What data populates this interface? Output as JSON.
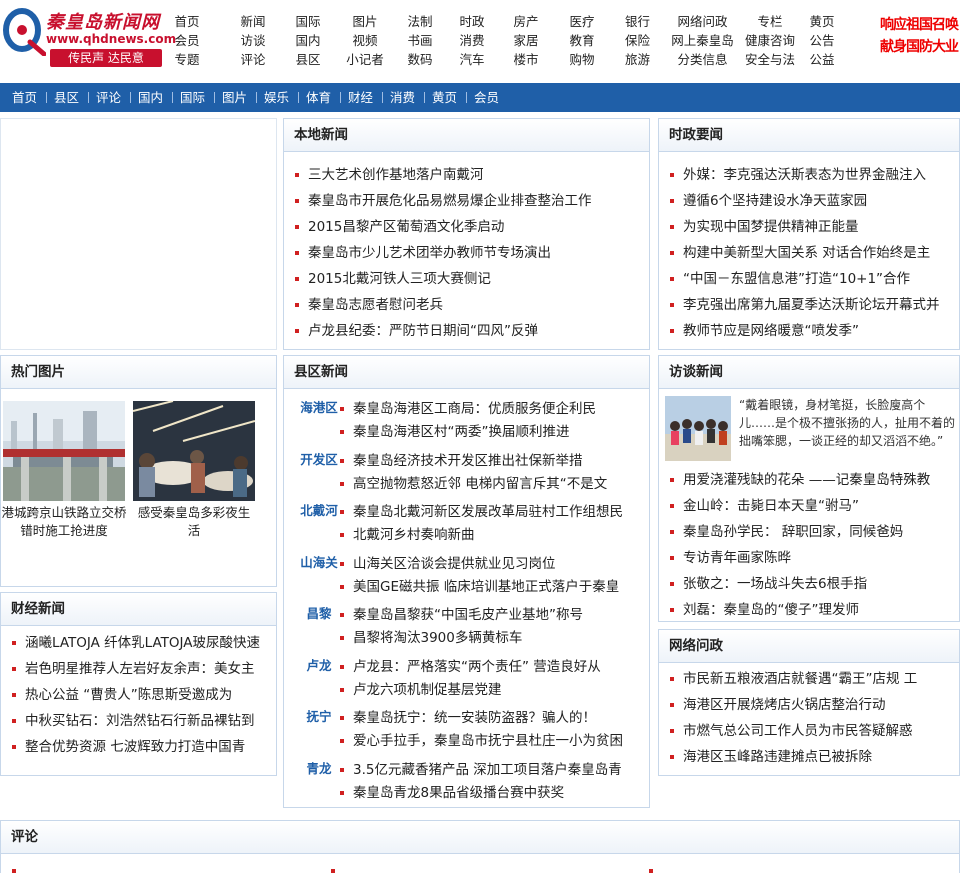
{
  "header": {
    "logo_name": "秦皇岛新闻网",
    "logo_url": "www.qhdnews.com",
    "logo_slogan": "传民声 达民意",
    "ad_line1": "响应祖国召唤",
    "ad_line2": "献身国防大业",
    "topnav_columns": [
      [
        "首页",
        "会员",
        "专题"
      ],
      [
        "新闻",
        "访谈",
        "评论"
      ],
      [
        "国际",
        "国内",
        "县区"
      ],
      [
        "图片",
        "视频",
        "小记者"
      ],
      [
        "法制",
        "书画",
        "数码"
      ],
      [
        "时政",
        "消费",
        "汽车"
      ],
      [
        "房产",
        "家居",
        "楼市"
      ],
      [
        "医疗",
        "教育",
        "购物"
      ],
      [
        "银行",
        "保险",
        "旅游"
      ],
      [
        "网络问政",
        "网上秦皇岛",
        "分类信息"
      ],
      [
        "专栏",
        "健康咨询",
        "安全与法"
      ],
      [
        "黄页",
        "公告",
        "公益"
      ]
    ]
  },
  "mainnav": [
    "首页",
    "县区",
    "评论",
    "国内",
    "国际",
    "图片",
    "娱乐",
    "体育",
    "财经",
    "消费",
    "黄页",
    "会员"
  ],
  "local_news": {
    "title": "本地新闻",
    "items": [
      "三大艺术创作基地落户南戴河",
      "秦皇岛市开展危化品易燃易爆企业排查整治工作",
      "2015昌黎产区葡萄酒文化季启动",
      "秦皇岛市少儿艺术团举办教师节专场演出",
      "2015北戴河铁人三项大赛侧记",
      "秦皇岛志愿者慰问老兵",
      "卢龙县纪委：严防节日期间“四风”反弹"
    ]
  },
  "politics": {
    "title": "时政要闻",
    "items": [
      "外媒：李克强达沃斯表态为世界金融注入",
      "遵循6个坚持建设水净天蓝家园",
      "为实现中国梦提供精神正能量",
      "构建中美新型大国关系 对话合作始终是主",
      "“中国－东盟信息港”打造“10+1”合作",
      "李克强出席第九届夏季达沃斯论坛开幕式并",
      "教师节应是网络暖意“喷发季”"
    ]
  },
  "hot_photos": {
    "title": "热门图片",
    "items": [
      {
        "caption": "港城跨京山铁路立交桥错时施工抢进度"
      },
      {
        "caption": "感受秦皇岛多彩夜生活"
      }
    ]
  },
  "finance": {
    "title": "财经新闻",
    "items": [
      "涵曦LATOJA 纤体乳LATOJA玻尿酸快速",
      "岩色明星推荐人左岩好友余声：美女主",
      "热心公益 “曹贵人”陈思斯受邀成为",
      "中秋买钻石：刘浩然钻石行新品裸钻到",
      "整合优势资源 七波辉致力打造中国青"
    ]
  },
  "county": {
    "title": "县区新闻",
    "groups": [
      {
        "name": "海港区",
        "items": [
          "秦皇岛海港区工商局：优质服务便企利民",
          "秦皇岛海港区村“两委”换届顺利推进"
        ]
      },
      {
        "name": "开发区",
        "items": [
          "秦皇岛经济技术开发区推出社保新举措",
          "高空抛物惹怒近邻 电梯内留言斥其“不是文"
        ]
      },
      {
        "name": "北戴河",
        "items": [
          "秦皇岛北戴河新区发展改革局驻村工作组想民",
          "北戴河乡村奏响新曲"
        ]
      },
      {
        "name": "山海关",
        "items": [
          "山海关区洽谈会提供就业见习岗位",
          "美国GE磁共振 临床培训基地正式落户于秦皇"
        ]
      },
      {
        "name": "昌黎",
        "items": [
          "秦皇岛昌黎获“中国毛皮产业基地”称号",
          "昌黎将淘汰3900多辆黄标车"
        ]
      },
      {
        "name": "卢龙",
        "items": [
          "卢龙县：严格落实“两个责任” 营造良好从",
          "卢龙六项机制促基层党建"
        ]
      },
      {
        "name": "抚宁",
        "items": [
          "秦皇岛抚宁：统一安装防盗器？骗人的！",
          "爱心手拉手，秦皇岛市抚宁县杜庄一小为贫困"
        ]
      },
      {
        "name": "青龙",
        "items": [
          "3.5亿元藏香猪产品 深加工项目落户秦皇岛青",
          "秦皇岛青龙8果品省级播台赛中获奖"
        ]
      }
    ]
  },
  "interview": {
    "title": "访谈新闻",
    "quote": "“戴着眼镜，身材笔挺，长脸廋高个儿……是个极不擅张扬的人，扯用不着的拙嘴笨腮，一谈正经的却又滔滔不绝。”",
    "items": [
      "用爱浇灌残缺的花朵 ——记秦皇岛特殊教",
      "金山岭：击毙日本天皇“驸马”",
      "秦皇岛孙学民： 辞职回家，同候爸妈",
      "专访青年画家陈晔",
      "张敬之：一场战斗失去6根手指",
      "刘磊：秦皇岛的“傻子”理发师"
    ]
  },
  "online_politics": {
    "title": "网络问政",
    "items": [
      "市民新五粮液酒店就餐遇“霸王”店规 工",
      "海港区开展烧烤店火锅店整治行动",
      "市燃气总公司工作人员为市民答疑解惑",
      "海港区玉峰路违建摊点已被拆除"
    ]
  },
  "comment": {
    "title": "评论"
  }
}
